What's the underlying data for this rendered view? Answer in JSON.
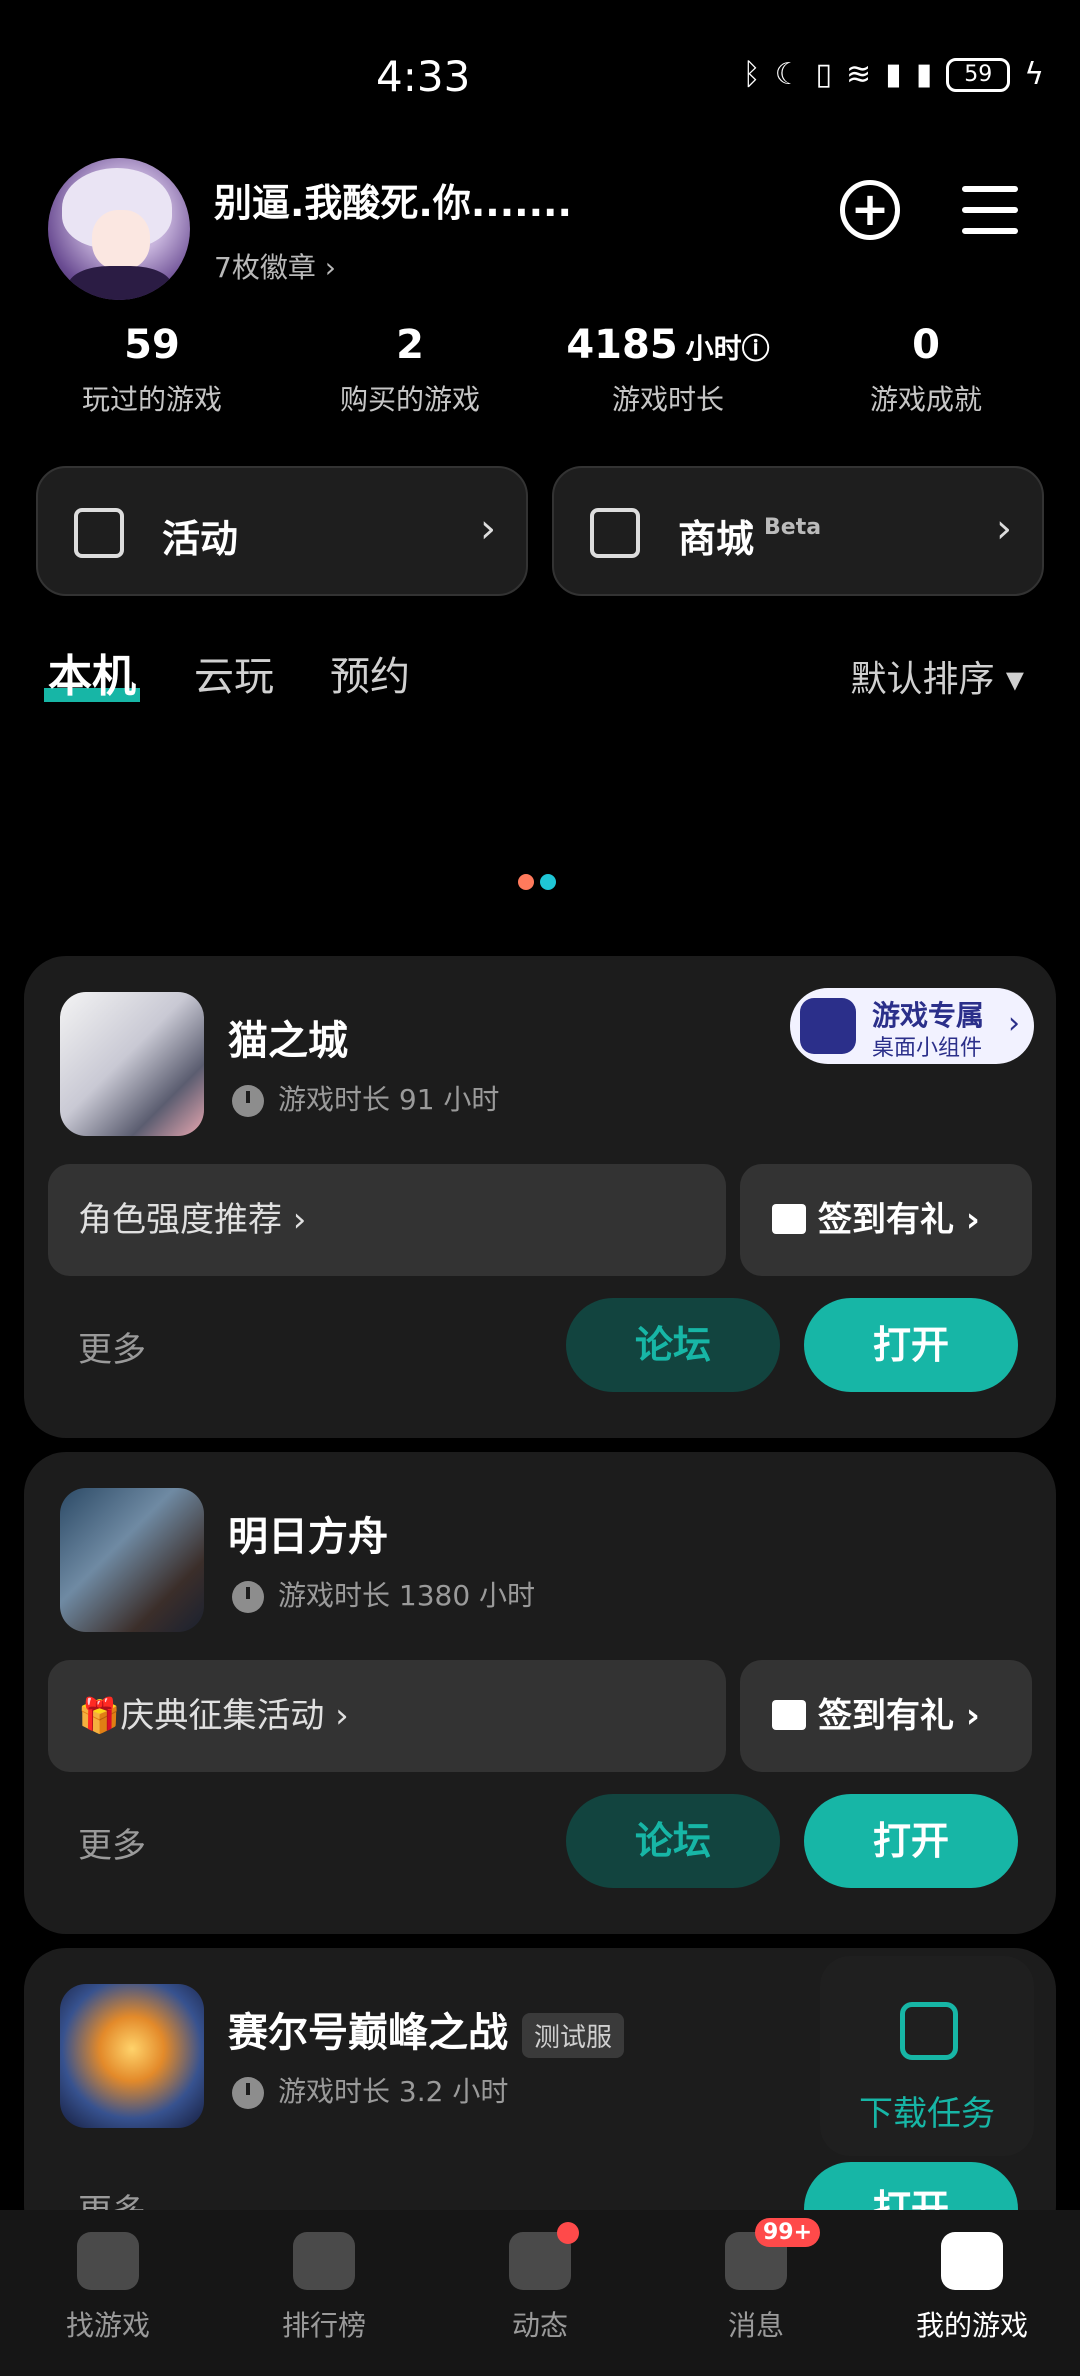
{
  "status_bar": {
    "time": "4:33",
    "icons": [
      "bluetooth-icon",
      "moon-icon",
      "vibrate-icon",
      "wifi-icon",
      "signal-icon",
      "signal-icon"
    ],
    "battery": "59"
  },
  "profile": {
    "username": "别逼.我酸死.你.......",
    "badges_link": "7枚徽章 ›"
  },
  "stats": [
    {
      "value": "59",
      "unit": "",
      "label": "玩过的游戏"
    },
    {
      "value": "2",
      "unit": "",
      "label": "购买的游戏"
    },
    {
      "value": "4185",
      "unit": "小时ⓘ",
      "label": "游戏时长"
    },
    {
      "value": "0",
      "unit": "",
      "label": "游戏成就"
    }
  ],
  "quick": {
    "activity": "活动",
    "store": "商城",
    "store_tag": "Beta"
  },
  "tabs": [
    "本机",
    "云玩",
    "预约"
  ],
  "sort_label": "默认排序 ▾",
  "games": [
    {
      "name": "猫之城",
      "playtime": "游戏时长 91 小时",
      "promo": "角色强度推荐 ›",
      "signin": "签到有礼 ›",
      "more": "更多",
      "forum": "论坛",
      "open": "打开",
      "widget_title": "游戏专属",
      "widget_sub": "桌面小组件"
    },
    {
      "name": "明日方舟",
      "playtime": "游戏时长 1380 小时",
      "promo": "🎁庆典征集活动 ›",
      "signin": "签到有礼 ›",
      "more": "更多",
      "forum": "论坛",
      "open": "打开"
    },
    {
      "name": "赛尔号巅峰之战",
      "tag": "测试服",
      "playtime": "游戏时长 3.2 小时",
      "more": "更多",
      "open": "打开"
    }
  ],
  "download_task": "下载任务",
  "nav": [
    {
      "label": "找游戏",
      "icon": "game-search-icon"
    },
    {
      "label": "排行榜",
      "icon": "ranking-icon"
    },
    {
      "label": "动态",
      "icon": "feed-icon"
    },
    {
      "label": "消息",
      "icon": "message-icon",
      "badge": "99+"
    },
    {
      "label": "我的游戏",
      "icon": "my-games-icon"
    }
  ],
  "colors": {
    "accent": "#17b6a6",
    "background": "#000000",
    "card": "#1c1c1c",
    "badge": "#ff4a4a"
  }
}
